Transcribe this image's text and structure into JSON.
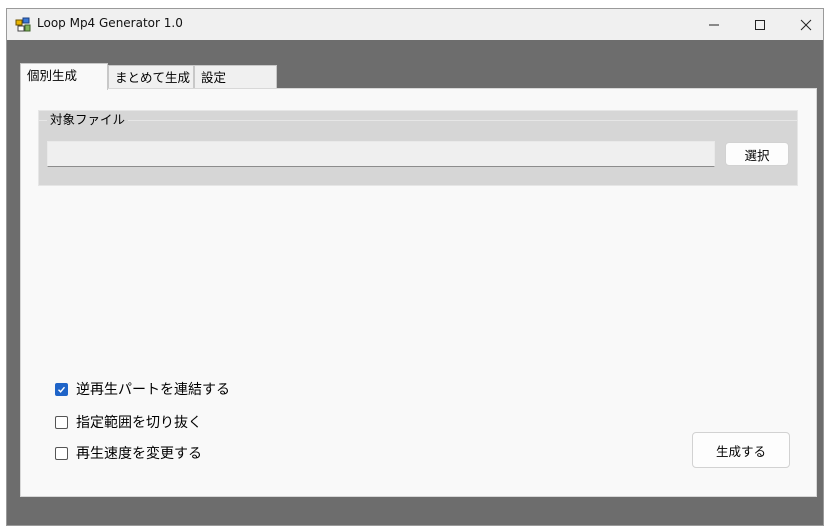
{
  "window": {
    "title": "Loop Mp4 Generator  1.0"
  },
  "tabs": [
    {
      "label": "個別生成",
      "active": true
    },
    {
      "label": "まとめて生成",
      "active": false
    },
    {
      "label": "設定",
      "active": false
    }
  ],
  "target_file": {
    "group_label": "対象ファイル",
    "value": "",
    "select_label": "選択"
  },
  "options": [
    {
      "label": "逆再生パートを連結する",
      "checked": true
    },
    {
      "label": "指定範囲を切り抜く",
      "checked": false
    },
    {
      "label": "再生速度を変更する",
      "checked": false
    }
  ],
  "actions": {
    "generate_label": "生成する"
  },
  "colors": {
    "accent": "#1f64c8",
    "backdrop": "#6d6d6d"
  }
}
